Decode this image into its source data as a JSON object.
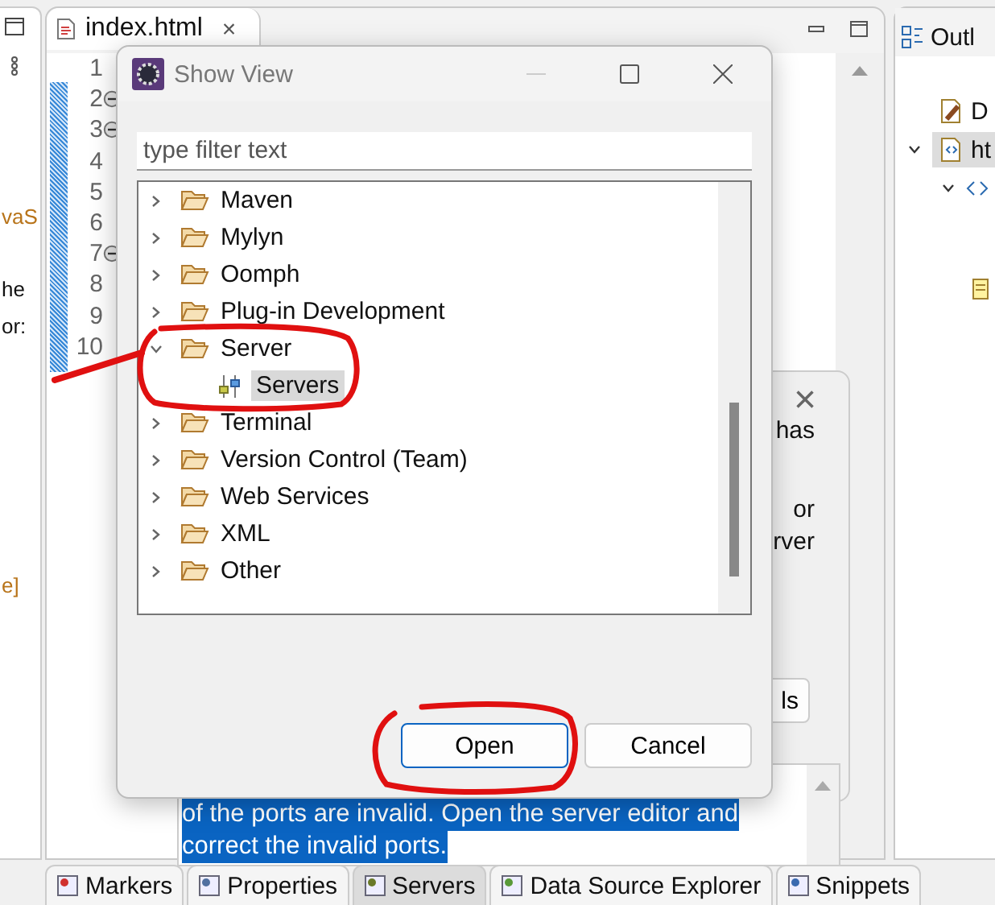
{
  "left_panel": {
    "texts": [
      "vaS",
      "he",
      "or:",
      "e]"
    ]
  },
  "editor": {
    "tab": {
      "label": "index.html",
      "close": "×"
    },
    "lines": [
      {
        "number": "1",
        "foldable": false
      },
      {
        "number": "2",
        "foldable": true
      },
      {
        "number": "3",
        "foldable": true
      },
      {
        "number": "4",
        "foldable": false
      },
      {
        "number": "5",
        "foldable": false
      },
      {
        "number": "6",
        "foldable": false
      },
      {
        "number": "7",
        "foldable": true
      },
      {
        "number": "8",
        "foldable": false
      },
      {
        "number": "9",
        "foldable": false
      },
      {
        "number": "10",
        "foldable": false
      }
    ]
  },
  "outline": {
    "title": "Outl",
    "items": [
      {
        "label": "D",
        "kind": "doctype",
        "selected": false
      },
      {
        "label": "ht",
        "kind": "file",
        "selected": true,
        "expanded": true
      }
    ]
  },
  "background_dialog": {
    "close": "×",
    "texts": [
      "has",
      "or",
      "rver"
    ],
    "button": "ls"
  },
  "message": {
    "lines": [
      "of the ports are invalid. Open the server editor and",
      "correct the invalid ports."
    ]
  },
  "bottom_tabs": [
    {
      "label": "Markers",
      "selected": false
    },
    {
      "label": "Properties",
      "selected": false
    },
    {
      "label": "Servers",
      "selected": true
    },
    {
      "label": "Data Source Explorer",
      "selected": false
    },
    {
      "label": "Snippets",
      "selected": false
    }
  ],
  "show_view_dialog": {
    "title": "Show View",
    "filter": {
      "placeholder": "type filter text"
    },
    "tree": [
      {
        "label": "Maven",
        "kind": "folder",
        "expanded": false,
        "selected": false
      },
      {
        "label": "Mylyn",
        "kind": "folder",
        "expanded": false,
        "selected": false
      },
      {
        "label": "Oomph",
        "kind": "folder",
        "expanded": false,
        "selected": false
      },
      {
        "label": "Plug-in Development",
        "kind": "folder",
        "expanded": false,
        "selected": false
      },
      {
        "label": "Server",
        "kind": "folder",
        "expanded": true,
        "selected": false,
        "children": [
          {
            "label": "Servers",
            "kind": "view",
            "selected": true
          }
        ]
      },
      {
        "label": "Terminal",
        "kind": "folder",
        "expanded": false,
        "selected": false
      },
      {
        "label": "Version Control (Team)",
        "kind": "folder",
        "expanded": false,
        "selected": false
      },
      {
        "label": "Web Services",
        "kind": "folder",
        "expanded": false,
        "selected": false
      },
      {
        "label": "XML",
        "kind": "folder",
        "expanded": false,
        "selected": false
      },
      {
        "label": "Other",
        "kind": "folder",
        "expanded": false,
        "selected": false
      }
    ],
    "buttons": [
      "Open",
      "Cancel"
    ]
  }
}
